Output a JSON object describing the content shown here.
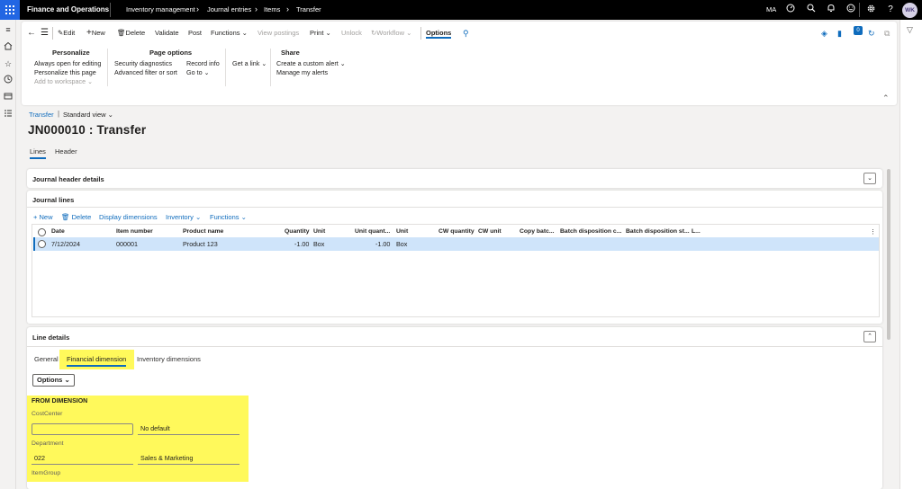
{
  "topbar": {
    "app_name": "Finance and Operations",
    "breadcrumbs": [
      "Inventory management",
      "Journal entries",
      "Items",
      "Transfer"
    ],
    "company": "MA",
    "user_initials": "WK"
  },
  "action_pane": {
    "edit": "Edit",
    "new": "New",
    "delete": "Delete",
    "validate": "Validate",
    "post": "Post",
    "functions": "Functions",
    "view_postings": "View postings",
    "print": "Print",
    "unlock": "Unlock",
    "workflow": "Workflow",
    "options": "Options",
    "badge_count": "0",
    "groups": {
      "personalize": {
        "title": "Personalize",
        "items": [
          "Always open for editing",
          "Personalize this page",
          "Add to workspace"
        ]
      },
      "page_options": {
        "title": "Page options",
        "items": [
          "Security diagnostics",
          "Advanced filter or sort",
          "Record info",
          "Go to"
        ]
      },
      "get_link": "Get a link",
      "share": {
        "title": "Share",
        "items": [
          "Create a custom alert",
          "Manage my alerts"
        ]
      }
    }
  },
  "page": {
    "breadcrumb_link": "Transfer",
    "view_name": "Standard view",
    "title": "JN000010 : Transfer",
    "tabs": [
      "Lines",
      "Header"
    ]
  },
  "header_details": {
    "title": "Journal header details"
  },
  "journal_lines": {
    "title": "Journal lines",
    "toolbar": {
      "new": "New",
      "delete": "Delete",
      "display_dimensions": "Display dimensions",
      "inventory": "Inventory",
      "functions": "Functions"
    },
    "columns": [
      "Date",
      "Item number",
      "Product name",
      "Quantity",
      "Unit",
      "Unit quant...",
      "Unit",
      "CW quantity",
      "CW unit",
      "Copy batc...",
      "Batch disposition c...",
      "Batch disposition st...",
      "L..."
    ],
    "rows": [
      {
        "date": "7/12/2024",
        "item_number": "000001",
        "product_name": "Product 123",
        "quantity": "-1.00",
        "unit": "Box",
        "unit_quantity": "-1.00",
        "unit2": "Box"
      }
    ]
  },
  "line_details": {
    "title": "Line details",
    "tabs": [
      "General",
      "Financial dimension",
      "Inventory dimensions"
    ],
    "options_label": "Options",
    "from_dimension": {
      "title": "FROM DIMENSION",
      "cost_center": {
        "label": "CostCenter",
        "value": "",
        "description": "No default"
      },
      "department": {
        "label": "Department",
        "value": "022",
        "description": "Sales & Marketing"
      },
      "item_group": {
        "label": "ItemGroup"
      }
    }
  },
  "colors": {
    "accent": "#0f6cbd",
    "highlight": "#fff95b",
    "topbar": "#000000",
    "waffle": "#2266e3"
  }
}
